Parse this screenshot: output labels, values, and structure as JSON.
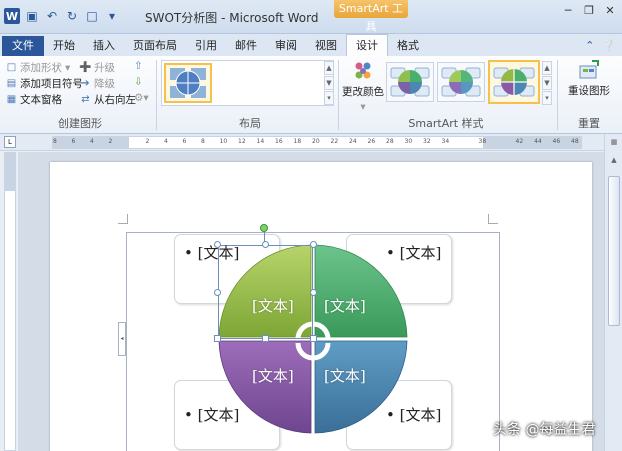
{
  "window": {
    "title": "SWOT分析图 - Microsoft Word",
    "context_tools": "SmartArt 工具",
    "word_icon": "W"
  },
  "tabs": [
    "文件",
    "开始",
    "插入",
    "页面布局",
    "引用",
    "邮件",
    "审阅",
    "视图",
    "设计",
    "格式"
  ],
  "ribbon": {
    "create": {
      "add_shape": "添加形状",
      "add_bullet": "添加项目符号",
      "text_pane": "文本窗格",
      "promote": "升级",
      "demote": "降级",
      "right_to_left": "从右向左",
      "group_label": "创建图形"
    },
    "layout": {
      "group_label": "布局"
    },
    "styles": {
      "change_colors": "更改颜色",
      "group_label": "SmartArt 样式"
    },
    "reset": {
      "reset_graphic": "重设图形",
      "group_label": "重置"
    }
  },
  "ruler": {
    "numbers": [
      "8",
      "6",
      "4",
      "2",
      "",
      "2",
      "4",
      "6",
      "8",
      "10",
      "12",
      "14",
      "16",
      "18",
      "20",
      "22",
      "24",
      "26",
      "28",
      "30",
      "32",
      "34",
      "",
      "38",
      "",
      "42",
      "44",
      "46",
      "48"
    ]
  },
  "smartart": {
    "card_tl": "[文本]",
    "card_tr": "[文本]",
    "card_bl": "[文本]",
    "card_br": "[文本]",
    "quad_tl": "[文本]",
    "quad_tr": "[文本]",
    "quad_bl": "[文本]",
    "quad_br": "[文本]",
    "bullet": "•",
    "colors": {
      "green_light": "#95b844",
      "green": "#4aae6c",
      "purple": "#8a5aa6",
      "blue": "#4b87b0"
    }
  },
  "watermark": "头条 @每益生君"
}
